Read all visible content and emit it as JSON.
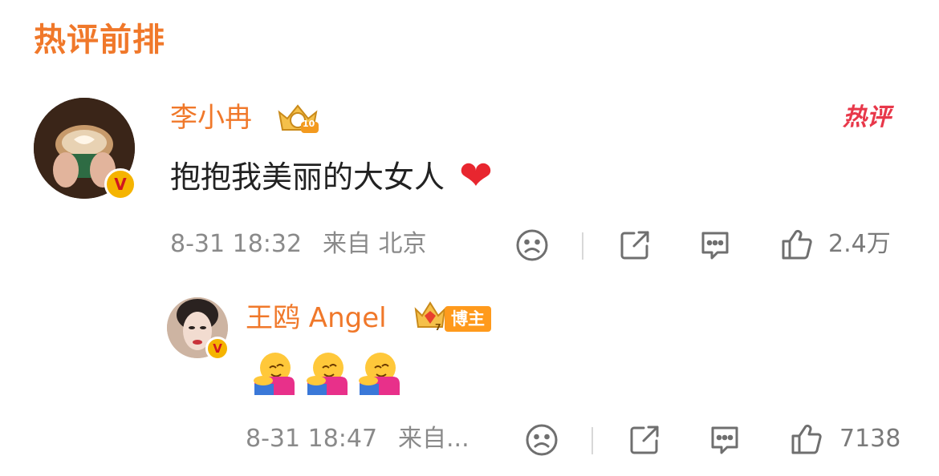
{
  "section": {
    "title": "热评前排"
  },
  "comment": {
    "user_name": "李小冉",
    "level_badge": "10",
    "hot_tag": "热评",
    "text": "抱抱我美丽的大女人",
    "emoji": "❤",
    "timestamp": "8-31 18:32",
    "source": "来自 北京",
    "likes": "2.4万",
    "verified_mark": "V"
  },
  "reply": {
    "user_name": "王鸥 Angel",
    "level_badge": "7",
    "role_badge": "博主",
    "timestamp": "8-31 18:47",
    "source": "来自...",
    "likes": "7138",
    "verified_mark": "V",
    "emoji_count": 3
  },
  "icons": [
    "dislike-face-icon",
    "share-icon",
    "comment-icon",
    "thumbs-up-icon",
    "crown-badge-icon",
    "heart-icon",
    "hug-emoji-icon"
  ],
  "colors": {
    "accent": "#f0782a",
    "text": "#222222",
    "meta": "#8a8a8a",
    "hot_red": "#e8384a",
    "heart": "#e8262f"
  }
}
